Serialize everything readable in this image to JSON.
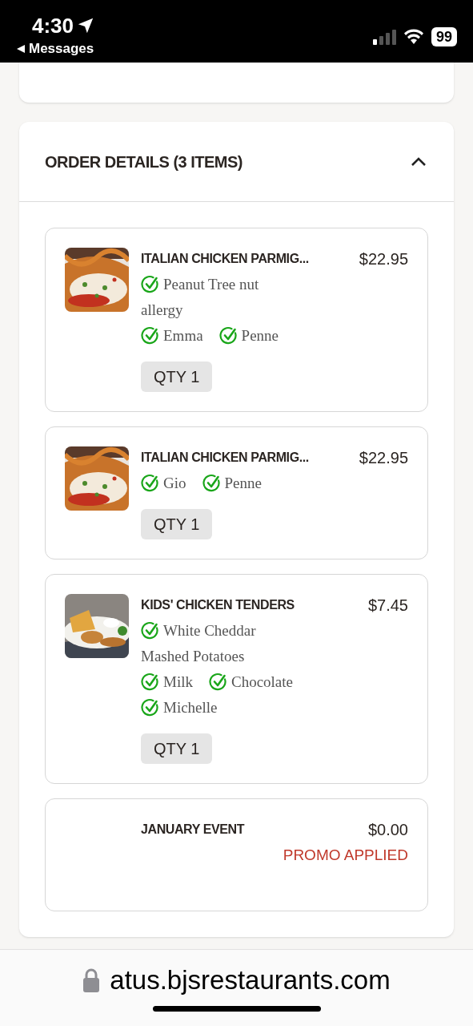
{
  "status_bar": {
    "time": "4:30",
    "back_label": "Messages",
    "battery": "99"
  },
  "order_details": {
    "title": "ORDER DETAILS (3 ITEMS)",
    "expanded": true,
    "items": [
      {
        "kind": "parmigiana",
        "name": "ITALIAN CHICKEN PARMIG...",
        "price": "$22.95",
        "option_lines": [
          [
            {
              "text": "Peanut Tree nut",
              "checked": true
            }
          ],
          [
            {
              "text": "allergy",
              "checked": false
            }
          ],
          [
            {
              "text": "Emma",
              "checked": true
            },
            {
              "text": "Penne",
              "checked": true
            }
          ]
        ],
        "qty": "QTY 1"
      },
      {
        "kind": "parmigiana",
        "name": "ITALIAN CHICKEN PARMIG...",
        "price": "$22.95",
        "option_lines": [
          [
            {
              "text": "Gio",
              "checked": true
            },
            {
              "text": "Penne",
              "checked": true
            }
          ]
        ],
        "qty": "QTY 1"
      },
      {
        "kind": "tenders",
        "name": "KIDS' CHICKEN TENDERS",
        "price": "$7.45",
        "option_lines": [
          [
            {
              "text": "White Cheddar",
              "checked": true
            }
          ],
          [
            {
              "text": "Mashed Potatoes",
              "checked": false
            }
          ],
          [
            {
              "text": "Milk",
              "checked": true
            },
            {
              "text": "Chocolate",
              "checked": true
            }
          ],
          [
            {
              "text": "Michelle",
              "checked": true
            }
          ]
        ],
        "qty": "QTY 1"
      },
      {
        "kind": "promo",
        "name": "JANUARY EVENT",
        "price": "$0.00",
        "note": "PROMO APPLIED"
      }
    ]
  },
  "browser": {
    "url": "atus.bjsrestaurants.com"
  }
}
